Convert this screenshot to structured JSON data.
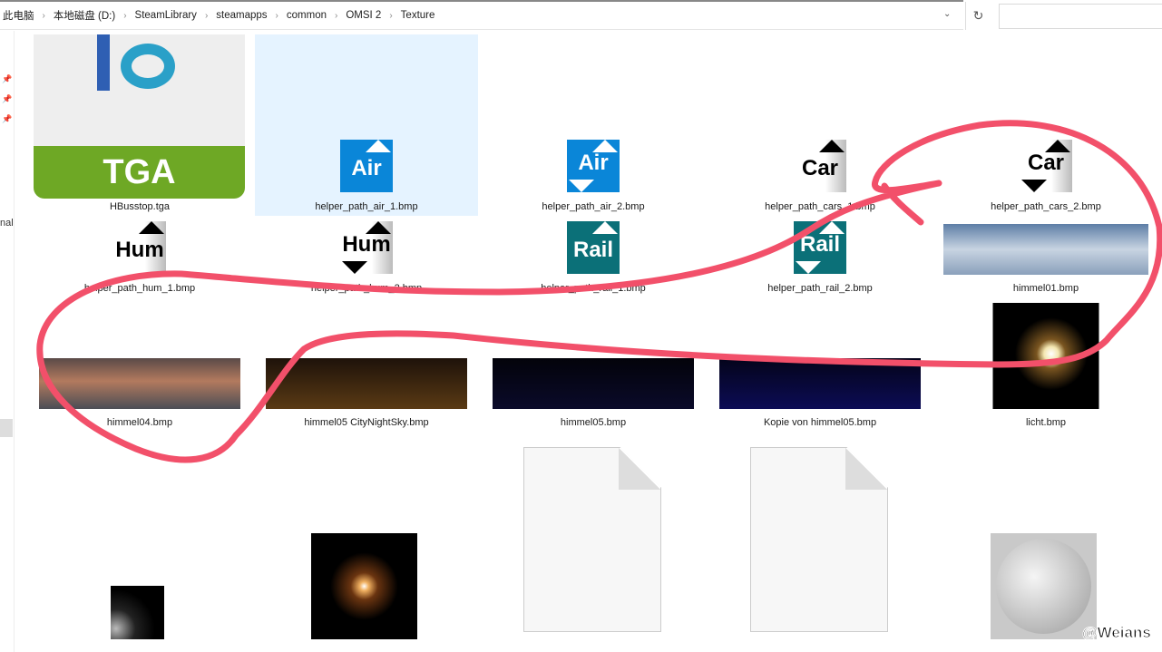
{
  "address_bar": {
    "crumbs": [
      "此电脑",
      "本地磁盘 (D:)",
      "SteamLibrary",
      "steamapps",
      "common",
      "OMSI 2",
      "Texture"
    ]
  },
  "nav_pane": {
    "partial_label": "nal"
  },
  "files": [
    {
      "name": "HBusstop.tga",
      "badge": "TGA"
    },
    {
      "name": "helper_path_air_1.bmp",
      "icon_text": "Air"
    },
    {
      "name": "helper_path_air_2.bmp",
      "icon_text": "Air"
    },
    {
      "name": "helper_path_cars_1.bmp",
      "icon_text": "Car"
    },
    {
      "name": "helper_path_cars_2.bmp",
      "icon_text": "Car"
    },
    {
      "name": "helper_path_hum_1.bmp",
      "icon_text": "Hum"
    },
    {
      "name": "helper_path_hum_2.bmp",
      "icon_text": "Hum"
    },
    {
      "name": "helper_path_rail_1.bmp",
      "icon_text": "Rail"
    },
    {
      "name": "helper_path_rail_2.bmp",
      "icon_text": "Rail"
    },
    {
      "name": "himmel01.bmp"
    },
    {
      "name": "himmel04.bmp"
    },
    {
      "name": "himmel05 CityNightSky.bmp"
    },
    {
      "name": "himmel05.bmp"
    },
    {
      "name": "Kopie von himmel05.bmp"
    },
    {
      "name": "licht.bmp"
    }
  ],
  "watermark": "@Weians",
  "colors": {
    "air": "#0a86d8",
    "rail": "#0b7078",
    "annotation": "#f2506a",
    "selection": "#e5f3ff"
  }
}
